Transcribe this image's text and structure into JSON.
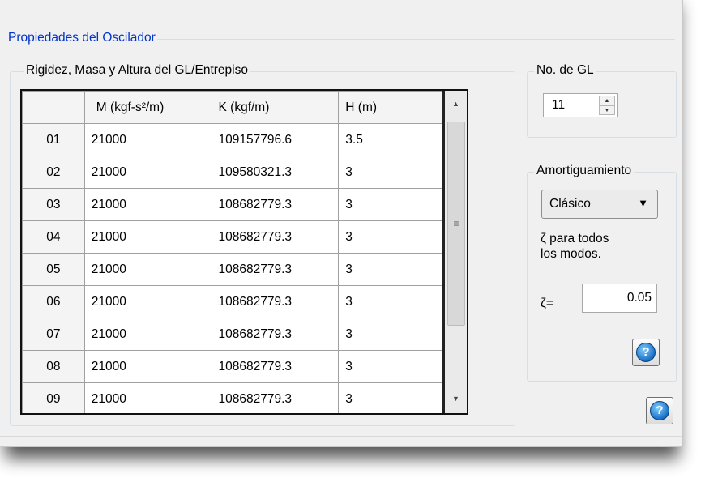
{
  "window": {
    "title": "Propiedades del Oscilador"
  },
  "grid_group": {
    "title": "Rigidez, Masa y Altura del GL/Entrepiso",
    "columns": [
      "",
      "M     (kgf-s²/m)",
      "K     (kgf/m)",
      "H     (m)"
    ],
    "rows": [
      [
        "01",
        "21000",
        "109157796.6",
        "3.5"
      ],
      [
        "02",
        "21000",
        "109580321.3",
        "3"
      ],
      [
        "03",
        "21000",
        "108682779.3",
        "3"
      ],
      [
        "04",
        "21000",
        "108682779.3",
        "3"
      ],
      [
        "05",
        "21000",
        "108682779.3",
        "3"
      ],
      [
        "06",
        "21000",
        "108682779.3",
        "3"
      ],
      [
        "07",
        "21000",
        "108682779.3",
        "3"
      ],
      [
        "08",
        "21000",
        "108682779.3",
        "3"
      ],
      [
        "09",
        "21000",
        "108682779.3",
        "3"
      ]
    ],
    "scrollbar": {
      "up_icon": "triangle-up-icon",
      "down_icon": "triangle-down-icon",
      "thumb_grip": "≡"
    }
  },
  "dof_group": {
    "title": "No. de GL",
    "spinner_value": "11"
  },
  "damping_group": {
    "title": "Amortiguamiento",
    "type_selected": "Clásico",
    "zeta_note_line1": "ζ  para todos",
    "zeta_note_line2": "los modos.",
    "zeta_label": "ζ=",
    "zeta_value": "0.05"
  },
  "help_buttons": {
    "glyph": "?",
    "icon": "help-icon",
    "color": "#1a6fc6"
  }
}
